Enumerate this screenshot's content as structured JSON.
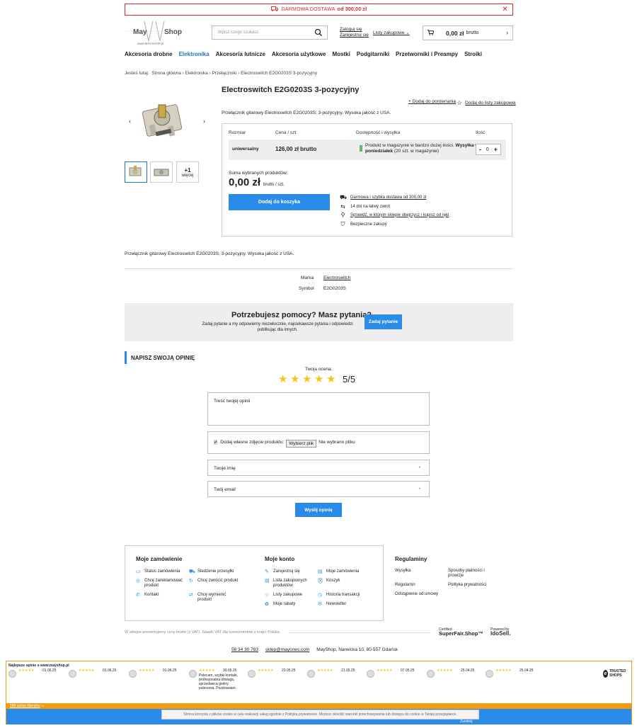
{
  "topbar": {
    "text": "DARMOWA DOSTAWA",
    "amount": "od 300,00 zł"
  },
  "header": {
    "logo_text": "MayOMShop",
    "logo_sub": "www.MAYSHOP.pl",
    "search_placeholder": "Wpisz czego szukasz",
    "login": "Zaloguj się",
    "register": "Zarejestruj się",
    "lists": "Listy zakupowe",
    "cart_amount": "0,00 zł",
    "cart_suffix": "brutto"
  },
  "nav": [
    "Akcesoria drobne",
    "Elektronika",
    "Akcesoria lutnicze",
    "Akcesoria użytkowe",
    "Mostki",
    "Podgitarniki",
    "Przetworniki i Preampy",
    "Stroiki"
  ],
  "breadcrumb": {
    "label": "Jesteś tutaj:",
    "items": [
      "Strona główna",
      "Elektronika",
      "Przełączniki",
      "Electroswitch E2G0203S 3-pozycyjny"
    ]
  },
  "product": {
    "title": "Electroswitch E2G0203S 3-pozycyjny",
    "compare": "+ Dodaj do porównania",
    "wishlist": "Dodaj do listy zakupowej",
    "short_desc": "Przełącznik gitarowy Electroswitch E2G0203S, 3-pozycyjny. Wysoka jakość z USA.",
    "more_plus": "+1",
    "more_label": "więcej",
    "table_headers": [
      "Rozmiar",
      "Cena / szt.",
      "Dostępność i wysyłka",
      "Ilość"
    ],
    "size": "uniwersalny",
    "price": "126,00 zł brutto",
    "stock_a": "Produkt w magazynie w bardzo dużej ilości.",
    "stock_b": "Wysyłka w poniedziałek",
    "stock_c": "(20 szt. w magazynie)",
    "qty": "0",
    "sum_label": "Suma wybranych produktów:",
    "sum": "0,00 zł",
    "sum_suffix": "brutto / szt.",
    "add_to_cart": "Dodaj do koszyka",
    "features": [
      "Darmowa i szybka dostawa od 300,00 zł",
      "14 dni na łatwy zwrot",
      "Sprawdź, w którym sklepie obejrzysz i kupisz od ręki",
      "Bezpieczne zakupy"
    ],
    "long_desc": "Przełącznik gitarowy Electroswitch E2G0203S, 3-pozycyjny. Wysoka jakość z USA.",
    "params": [
      {
        "k": "Marka",
        "v": "Electroswitch"
      },
      {
        "k": "Symbol",
        "v": "E2G0203S"
      }
    ]
  },
  "help": {
    "title": "Potrzebujesz pomocy? Masz pytania?",
    "text": "Zadaj pytanie a my odpowiemy niezwłocznie, najciekawsze pytania i odpowiedzi publikując dla innych.",
    "button": "Zadaj pytanie"
  },
  "review": {
    "heading": "NAPISZ SWOJĄ OPINIĘ",
    "rating_label": "Twoja ocena:",
    "rating": 5,
    "score": "5/5",
    "text_placeholder": "Treść twojej opinii",
    "photo_label": "Dodaj własne zdjęcie produktu:",
    "file_button": "Wybierz plik",
    "file_none": "Nie wybrano pliku",
    "name_placeholder": "Twoje imię",
    "email_placeholder": "Twój email",
    "submit": "Wyślij opinię"
  },
  "footer": {
    "orders_title": "Moje zamówienie",
    "orders": [
      "Status zamówienia",
      "Śledzenie przesyłki",
      "Chcę zareklamować produkt",
      "Chcę zwrócić produkt",
      "Kontakt",
      "Chcę wymienić produkt"
    ],
    "account_title": "Moje konto",
    "account": [
      "Zarejestruj się",
      "Moje zamówienia",
      "Lista zakupionych produktów",
      "Koszyk",
      "Listy zakupowe",
      "Historia transakcji",
      "Moje rabaty",
      "Newsletter"
    ],
    "rules_title": "Regulaminy",
    "rules": [
      "Wysyłka",
      "Sposoby płatności i prowizje",
      "Regulamin",
      "Polityka prywatności",
      "Odstąpienie od umowy"
    ],
    "vat": "W sklepie prezentujemy ceny brutto (z VAT). Stawki VAT dla konsumentów z kraju: Polska.",
    "cert_small": "Certified",
    "cert_big": "SuperFair.Shop™",
    "powered": "Powered by",
    "idosell": "IdoSell.",
    "phone": "58 34 30 783",
    "email": "sklep@mayones.com",
    "address": "MayShop, Narwicka 10, 80-557 Gdańsk"
  },
  "trusted": {
    "title": "Najlepsze opinie o www.mayshop.pl",
    "dates": [
      "01.06.25",
      "01.06.25",
      "01.06.25",
      "30.05.25",
      "23.05.25",
      "21.05.25",
      "07.05.25",
      "25.04.25",
      "25.04.25"
    ],
    "review_text": "Polecam, szybki kontakt, profesjonalna obsługa, sprzedawca godny polecenia. Pozdrawiam.",
    "logo": "TRUSTED SHOPS",
    "count": "180 opinie klientów"
  },
  "cookie": {
    "text": "Strona korzysta z plików cookie w celu realizacji usług zgodnie z Polityką prywatności. Możesz określić warunki przechowywania lub dostępu do cookie w Twojej przeglądarce.",
    "close": "Zamknij"
  },
  "colors": {
    "accent": "#2a8ce8",
    "alert": "#d9252f",
    "trusted": "#f39c12",
    "star": "#f5c518"
  }
}
